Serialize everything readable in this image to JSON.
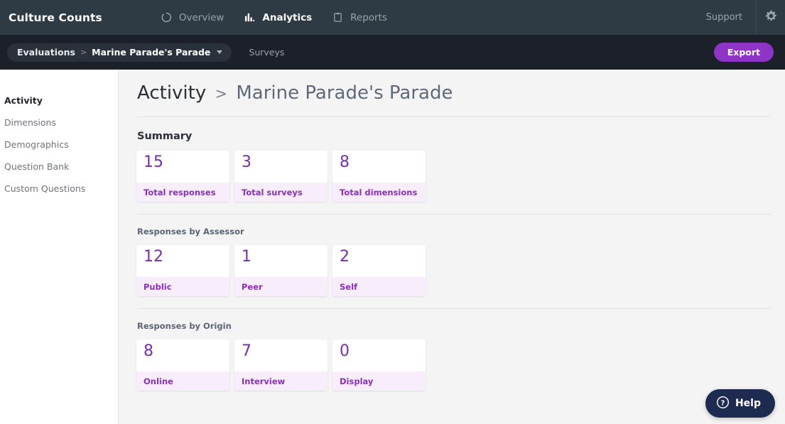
{
  "topbar": {
    "brand": "Culture Counts",
    "nav": [
      {
        "label": "Overview",
        "icon": "circle-outline-icon",
        "active": false
      },
      {
        "label": "Analytics",
        "icon": "bar-chart-icon",
        "active": true
      },
      {
        "label": "Reports",
        "icon": "document-icon",
        "active": false
      }
    ],
    "support_label": "Support",
    "settings_icon": "gear-icon",
    "background": "#2f3b44"
  },
  "breadcrumb_bar": {
    "crumb_root": "Evaluations",
    "crumb_separator": ">",
    "crumb_current": "Marine Parade's Parade",
    "dropdown_icon": "chevron-down-icon",
    "surveys_label": "Surveys",
    "export_label": "Export",
    "export_color": "#8e35c8",
    "background": "#1c2028"
  },
  "sidebar": {
    "items": [
      {
        "label": "Activity",
        "active": true
      },
      {
        "label": "Dimensions",
        "active": false
      },
      {
        "label": "Demographics",
        "active": false
      },
      {
        "label": "Question Bank",
        "active": false
      },
      {
        "label": "Custom Questions",
        "active": false
      }
    ]
  },
  "page": {
    "title_primary": "Activity",
    "title_separator": ">",
    "title_secondary": "Marine Parade's Parade",
    "sections": [
      {
        "heading": "Summary",
        "heading_style": "large",
        "cards": [
          {
            "value": "15",
            "label": "Total responses"
          },
          {
            "value": "3",
            "label": "Total surveys"
          },
          {
            "value": "8",
            "label": "Total dimensions"
          }
        ]
      },
      {
        "heading": "Responses by Assessor",
        "heading_style": "small",
        "cards": [
          {
            "value": "12",
            "label": "Public"
          },
          {
            "value": "1",
            "label": "Peer"
          },
          {
            "value": "2",
            "label": "Self"
          }
        ]
      },
      {
        "heading": "Responses by Origin",
        "heading_style": "small",
        "cards": [
          {
            "value": "8",
            "label": "Online"
          },
          {
            "value": "7",
            "label": "Interview"
          },
          {
            "value": "0",
            "label": "Display"
          }
        ]
      }
    ],
    "accent_number_color": "#7a2bae",
    "accent_label_color": "#8b2fbd",
    "card_footer_color": "#f8edfb"
  },
  "help_widget": {
    "label": "Help",
    "icon": "question-circle-icon",
    "background": "#1f2a51"
  }
}
